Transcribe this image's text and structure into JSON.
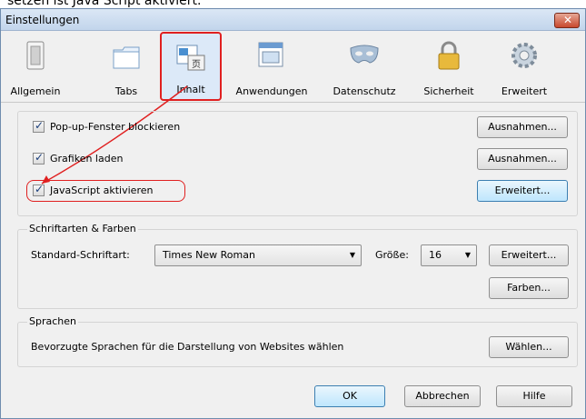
{
  "top_text": "setzen ist Java Script aktiviert.",
  "window": {
    "title": "Einstellungen",
    "close_glyph": "✕"
  },
  "toolbar": {
    "items": [
      {
        "label": "Allgemein",
        "icon": "switch-icon"
      },
      {
        "label": "Tabs",
        "icon": "tabs-icon"
      },
      {
        "label": "Inhalt",
        "icon": "content-icon",
        "selected": true
      },
      {
        "label": "Anwendungen",
        "icon": "applications-icon"
      },
      {
        "label": "Datenschutz",
        "icon": "mask-icon"
      },
      {
        "label": "Sicherheit",
        "icon": "lock-icon"
      },
      {
        "label": "Erweitert",
        "icon": "gear-icon"
      }
    ]
  },
  "content": {
    "popup_label": "Pop-up-Fenster blockieren",
    "popup_button": "Ausnahmen...",
    "images_label": "Grafiken laden",
    "images_button": "Ausnahmen...",
    "js_label": "JavaScript aktivieren",
    "js_button": "Erweitert..."
  },
  "fonts": {
    "legend": "Schriftarten & Farben",
    "default_font_label": "Standard-Schriftart:",
    "default_font_value": "Times New Roman",
    "size_label": "Größe:",
    "size_value": "16",
    "advanced_button": "Erweitert...",
    "colors_button": "Farben..."
  },
  "languages": {
    "legend": "Sprachen",
    "description": "Bevorzugte Sprachen für die Darstellung von Websites wählen",
    "choose_button": "Wählen..."
  },
  "footer": {
    "ok": "OK",
    "cancel": "Abbrechen",
    "help": "Hilfe"
  },
  "colors": {
    "annotation": "#e02020",
    "selected_bg": "#dce9f8"
  }
}
